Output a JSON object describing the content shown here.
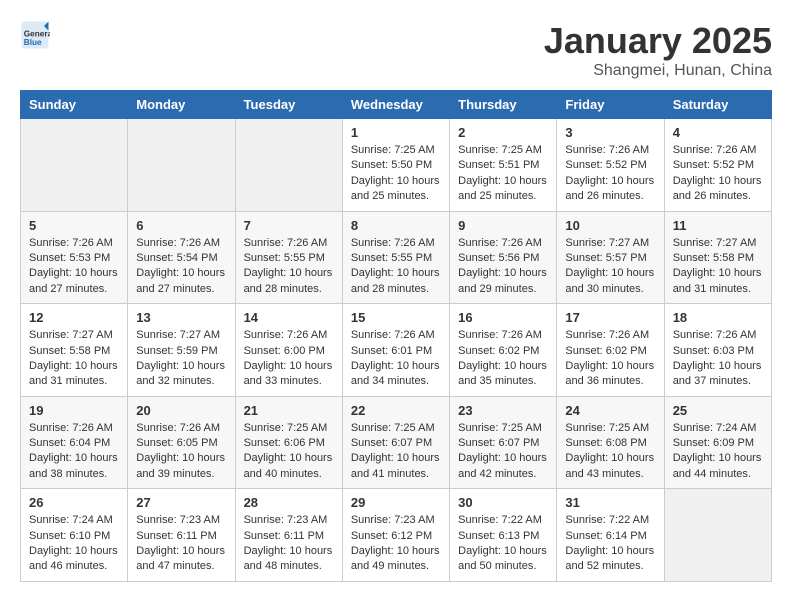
{
  "logo": {
    "text_general": "General",
    "text_blue": "Blue"
  },
  "header": {
    "month": "January 2025",
    "location": "Shangmei, Hunan, China"
  },
  "weekdays": [
    "Sunday",
    "Monday",
    "Tuesday",
    "Wednesday",
    "Thursday",
    "Friday",
    "Saturday"
  ],
  "weeks": [
    [
      {
        "day": "",
        "info": ""
      },
      {
        "day": "",
        "info": ""
      },
      {
        "day": "",
        "info": ""
      },
      {
        "day": "1",
        "info": "Sunrise: 7:25 AM\nSunset: 5:50 PM\nDaylight: 10 hours and 25 minutes."
      },
      {
        "day": "2",
        "info": "Sunrise: 7:25 AM\nSunset: 5:51 PM\nDaylight: 10 hours and 25 minutes."
      },
      {
        "day": "3",
        "info": "Sunrise: 7:26 AM\nSunset: 5:52 PM\nDaylight: 10 hours and 26 minutes."
      },
      {
        "day": "4",
        "info": "Sunrise: 7:26 AM\nSunset: 5:52 PM\nDaylight: 10 hours and 26 minutes."
      }
    ],
    [
      {
        "day": "5",
        "info": "Sunrise: 7:26 AM\nSunset: 5:53 PM\nDaylight: 10 hours and 27 minutes."
      },
      {
        "day": "6",
        "info": "Sunrise: 7:26 AM\nSunset: 5:54 PM\nDaylight: 10 hours and 27 minutes."
      },
      {
        "day": "7",
        "info": "Sunrise: 7:26 AM\nSunset: 5:55 PM\nDaylight: 10 hours and 28 minutes."
      },
      {
        "day": "8",
        "info": "Sunrise: 7:26 AM\nSunset: 5:55 PM\nDaylight: 10 hours and 28 minutes."
      },
      {
        "day": "9",
        "info": "Sunrise: 7:26 AM\nSunset: 5:56 PM\nDaylight: 10 hours and 29 minutes."
      },
      {
        "day": "10",
        "info": "Sunrise: 7:27 AM\nSunset: 5:57 PM\nDaylight: 10 hours and 30 minutes."
      },
      {
        "day": "11",
        "info": "Sunrise: 7:27 AM\nSunset: 5:58 PM\nDaylight: 10 hours and 31 minutes."
      }
    ],
    [
      {
        "day": "12",
        "info": "Sunrise: 7:27 AM\nSunset: 5:58 PM\nDaylight: 10 hours and 31 minutes."
      },
      {
        "day": "13",
        "info": "Sunrise: 7:27 AM\nSunset: 5:59 PM\nDaylight: 10 hours and 32 minutes."
      },
      {
        "day": "14",
        "info": "Sunrise: 7:26 AM\nSunset: 6:00 PM\nDaylight: 10 hours and 33 minutes."
      },
      {
        "day": "15",
        "info": "Sunrise: 7:26 AM\nSunset: 6:01 PM\nDaylight: 10 hours and 34 minutes."
      },
      {
        "day": "16",
        "info": "Sunrise: 7:26 AM\nSunset: 6:02 PM\nDaylight: 10 hours and 35 minutes."
      },
      {
        "day": "17",
        "info": "Sunrise: 7:26 AM\nSunset: 6:02 PM\nDaylight: 10 hours and 36 minutes."
      },
      {
        "day": "18",
        "info": "Sunrise: 7:26 AM\nSunset: 6:03 PM\nDaylight: 10 hours and 37 minutes."
      }
    ],
    [
      {
        "day": "19",
        "info": "Sunrise: 7:26 AM\nSunset: 6:04 PM\nDaylight: 10 hours and 38 minutes."
      },
      {
        "day": "20",
        "info": "Sunrise: 7:26 AM\nSunset: 6:05 PM\nDaylight: 10 hours and 39 minutes."
      },
      {
        "day": "21",
        "info": "Sunrise: 7:25 AM\nSunset: 6:06 PM\nDaylight: 10 hours and 40 minutes."
      },
      {
        "day": "22",
        "info": "Sunrise: 7:25 AM\nSunset: 6:07 PM\nDaylight: 10 hours and 41 minutes."
      },
      {
        "day": "23",
        "info": "Sunrise: 7:25 AM\nSunset: 6:07 PM\nDaylight: 10 hours and 42 minutes."
      },
      {
        "day": "24",
        "info": "Sunrise: 7:25 AM\nSunset: 6:08 PM\nDaylight: 10 hours and 43 minutes."
      },
      {
        "day": "25",
        "info": "Sunrise: 7:24 AM\nSunset: 6:09 PM\nDaylight: 10 hours and 44 minutes."
      }
    ],
    [
      {
        "day": "26",
        "info": "Sunrise: 7:24 AM\nSunset: 6:10 PM\nDaylight: 10 hours and 46 minutes."
      },
      {
        "day": "27",
        "info": "Sunrise: 7:23 AM\nSunset: 6:11 PM\nDaylight: 10 hours and 47 minutes."
      },
      {
        "day": "28",
        "info": "Sunrise: 7:23 AM\nSunset: 6:11 PM\nDaylight: 10 hours and 48 minutes."
      },
      {
        "day": "29",
        "info": "Sunrise: 7:23 AM\nSunset: 6:12 PM\nDaylight: 10 hours and 49 minutes."
      },
      {
        "day": "30",
        "info": "Sunrise: 7:22 AM\nSunset: 6:13 PM\nDaylight: 10 hours and 50 minutes."
      },
      {
        "day": "31",
        "info": "Sunrise: 7:22 AM\nSunset: 6:14 PM\nDaylight: 10 hours and 52 minutes."
      },
      {
        "day": "",
        "info": ""
      }
    ]
  ]
}
